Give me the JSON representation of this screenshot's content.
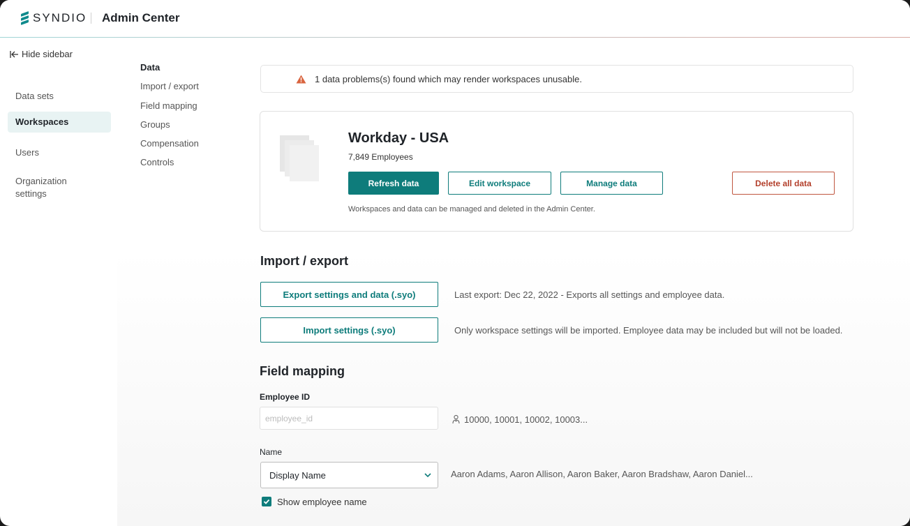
{
  "header": {
    "brand": "SYNDIO",
    "app_title": "Admin Center"
  },
  "sidebar": {
    "hide_label": "Hide sidebar",
    "items": [
      {
        "label": "Data sets"
      },
      {
        "label": "Workspaces"
      },
      {
        "label": "Users"
      },
      {
        "label": "Organization settings"
      }
    ]
  },
  "subnav": {
    "title": "Data",
    "items": [
      "Import / export",
      "Field mapping",
      "Groups",
      "Compensation",
      "Controls"
    ]
  },
  "alert": {
    "text": "1 data problems(s) found which may render workspaces unusable.",
    "icon": "warning-triangle-icon"
  },
  "workspace": {
    "title": "Workday - USA",
    "employees": "7,849 Employees",
    "buttons": {
      "refresh": "Refresh data",
      "edit": "Edit workspace",
      "manage": "Manage data",
      "delete": "Delete all data"
    },
    "note": "Workspaces and data can be managed and deleted in the Admin Center."
  },
  "import_export": {
    "heading": "Import / export",
    "export_button": "Export settings and data (.syo)",
    "export_desc": "Last export: Dec 22, 2022 - Exports all settings and employee data.",
    "import_button": "Import settings (.syo)",
    "import_desc": "Only workspace settings will be imported. Employee data may be included but will not be loaded."
  },
  "field_mapping": {
    "heading": "Field mapping",
    "employee_id": {
      "label": "Employee ID",
      "placeholder": "employee_id",
      "sample": "10000, 10001, 10002, 10003..."
    },
    "name": {
      "label": "Name",
      "value": "Display Name",
      "sample": "Aaron Adams, Aaron Allison, Aaron Baker, Aaron Bradshaw, Aaron Daniel..."
    },
    "show_name_label": "Show employee name",
    "show_name_checked": true
  },
  "colors": {
    "accent": "#0e7c7b",
    "danger": "#b3402c",
    "active_nav_bg": "#e8f3f3",
    "warning": "#d9643f"
  }
}
